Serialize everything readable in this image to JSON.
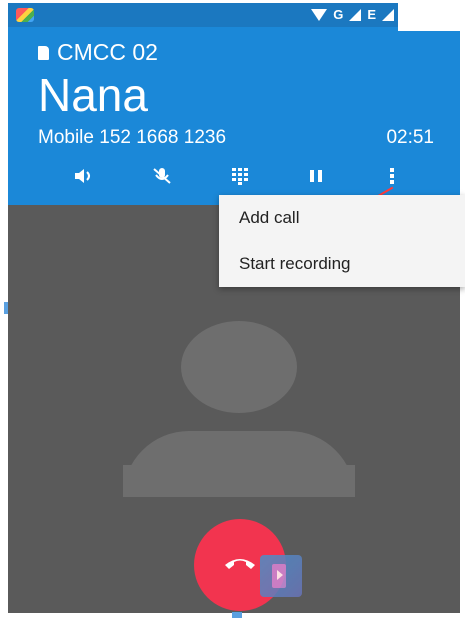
{
  "status_bar": {
    "network_label": "G",
    "data_label": "E",
    "icons": [
      "app-icon",
      "wifi-icon",
      "signal-icon",
      "signal-icon"
    ]
  },
  "call": {
    "carrier": "CMCC 02",
    "caller_name": "Nana",
    "caller_number": "Mobile 152 1668 1236",
    "timer": "02:51"
  },
  "controls": [
    {
      "name": "speaker-icon"
    },
    {
      "name": "mute-icon"
    },
    {
      "name": "dialpad-icon"
    },
    {
      "name": "hold-icon"
    },
    {
      "name": "more-options-icon"
    }
  ],
  "menu": {
    "items": [
      "Add call",
      "Start recording"
    ]
  },
  "colors": {
    "header": "#1b88d8",
    "status_bar": "#1b78c0",
    "body": "#5a5a5a",
    "end_call": "#f2344f",
    "menu_bg": "#f4f4f4"
  }
}
